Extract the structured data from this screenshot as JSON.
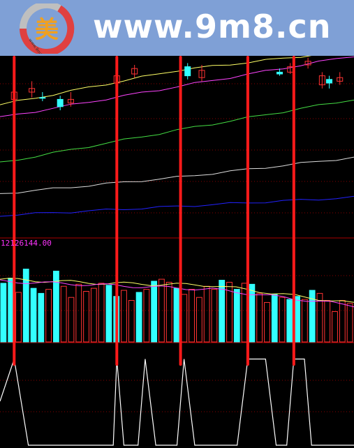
{
  "banner": {
    "site_text": "www.9m8.cn",
    "logo_char": "美",
    "logo_ring_text": "www.9m8.cn",
    "colors": {
      "background": "#7fa0d6",
      "text": "#ffffff",
      "logo_ring_gray": "#bfbfbf",
      "logo_ring_red": "#e04040",
      "logo_char": "#f0a020"
    }
  },
  "chart_data": [
    {
      "type": "line",
      "panel": "price",
      "title": "",
      "xlabel": "",
      "ylabel": "",
      "ylim": [
        0,
        100
      ],
      "grid": true,
      "x": [
        0,
        100
      ],
      "series": [
        {
          "values_y": [
            [
              0,
              73
            ],
            [
              50,
              92
            ],
            [
              100,
              103
            ]
          ],
          "color": "#ffff66"
        },
        {
          "values_y": [
            [
              0,
              66
            ],
            [
              50,
              83
            ],
            [
              100,
              100
            ]
          ],
          "color": "#ff44ff"
        },
        {
          "values_y": [
            [
              0,
              41
            ],
            [
              50,
              59
            ],
            [
              100,
              76
            ]
          ],
          "color": "#44dd44"
        },
        {
          "values_y": [
            [
              0,
              24
            ],
            [
              50,
              33
            ],
            [
              100,
              44
            ]
          ],
          "color": "#dddddd"
        },
        {
          "values_y": [
            [
              0,
              12
            ],
            [
              50,
              17
            ],
            [
              100,
              22
            ]
          ],
          "color": "#2222ff"
        }
      ],
      "candles": [
        {
          "x": 4,
          "open": 76,
          "close": 80,
          "high": 84,
          "low": 74,
          "up": true
        },
        {
          "x": 9,
          "open": 80,
          "close": 82,
          "high": 86,
          "low": 77,
          "up": true
        },
        {
          "x": 12,
          "open": 77,
          "close": 77,
          "high": 80,
          "low": 75,
          "up": false
        },
        {
          "x": 17,
          "open": 76,
          "close": 72,
          "high": 78,
          "low": 70,
          "up": false
        },
        {
          "x": 20,
          "open": 74,
          "close": 76,
          "high": 80,
          "low": 72,
          "up": true
        },
        {
          "x": 33,
          "open": 85,
          "close": 89,
          "high": 93,
          "low": 83,
          "up": true
        },
        {
          "x": 38,
          "open": 90,
          "close": 93,
          "high": 95,
          "low": 88,
          "up": true
        },
        {
          "x": 53,
          "open": 94,
          "close": 89,
          "high": 96,
          "low": 87,
          "up": false
        },
        {
          "x": 57,
          "open": 88,
          "close": 92,
          "high": 95,
          "low": 86,
          "up": true
        },
        {
          "x": 79,
          "open": 91,
          "close": 90,
          "high": 93,
          "low": 89,
          "up": false
        },
        {
          "x": 82,
          "open": 91,
          "close": 94,
          "high": 96,
          "low": 90,
          "up": true
        },
        {
          "x": 87,
          "open": 95,
          "close": 97,
          "high": 99,
          "low": 93,
          "up": true
        },
        {
          "x": 91,
          "open": 84,
          "close": 89,
          "high": 91,
          "low": 82,
          "up": true
        },
        {
          "x": 93,
          "open": 87,
          "close": 85,
          "high": 89,
          "low": 82,
          "up": false
        },
        {
          "x": 96,
          "open": 86,
          "close": 88,
          "high": 91,
          "low": 84,
          "up": true
        }
      ]
    },
    {
      "type": "bar",
      "panel": "volume",
      "title": "",
      "ylabel": "",
      "y_max_label": "12126144.00",
      "ylim": [
        0,
        100
      ],
      "grid": true,
      "values": [
        58,
        63,
        49,
        72,
        53,
        48,
        52,
        70,
        55,
        44,
        57,
        50,
        53,
        58,
        56,
        45,
        51,
        41,
        49,
        52,
        60,
        62,
        59,
        53,
        47,
        52,
        44,
        55,
        52,
        61,
        59,
        52,
        58,
        57,
        48,
        39,
        47,
        44,
        42,
        45,
        42,
        51,
        48,
        41,
        30,
        41,
        38
      ],
      "filled": [
        true,
        true,
        false,
        true,
        true,
        true,
        false,
        true,
        false,
        false,
        false,
        false,
        false,
        false,
        true,
        true,
        false,
        false,
        true,
        false,
        true,
        false,
        false,
        true,
        false,
        false,
        false,
        false,
        false,
        true,
        false,
        true,
        false,
        true,
        false,
        false,
        true,
        false,
        true,
        true,
        false,
        true,
        false,
        false,
        false,
        false,
        false
      ],
      "bar_colors": {
        "filled": "#33ffff",
        "hollow": "#ff3333"
      },
      "series": [
        {
          "values_y": [
            [
              0,
              62
            ],
            [
              30,
              58
            ],
            [
              60,
              56
            ],
            [
              100,
              38
            ]
          ],
          "color": "#ffff66"
        },
        {
          "values_y": [
            [
              0,
              60
            ],
            [
              30,
              56
            ],
            [
              60,
              52
            ],
            [
              100,
              36
            ]
          ],
          "color": "#ff44ff"
        }
      ]
    },
    {
      "type": "line",
      "panel": "signal",
      "title": "",
      "ylabel": "",
      "ylim": [
        0,
        1
      ],
      "grid": true,
      "signal_x": [
        4,
        33,
        51,
        70,
        83
      ],
      "series": [
        {
          "values_y": [
            [
              0,
              0.5
            ],
            [
              4,
              0.98
            ],
            [
              8,
              0.0
            ],
            [
              32,
              0.0
            ],
            [
              33,
              0.98
            ],
            [
              35,
              0.0
            ],
            [
              39,
              0.0
            ],
            [
              41,
              0.98
            ],
            [
              44,
              0.0
            ],
            [
              50,
              0.0
            ],
            [
              52,
              0.98
            ],
            [
              55,
              0.0
            ],
            [
              67,
              0.0
            ],
            [
              70,
              0.98
            ],
            [
              75,
              0.98
            ],
            [
              78,
              0.0
            ],
            [
              81,
              0.0
            ],
            [
              83,
              0.98
            ],
            [
              86,
              0.98
            ],
            [
              88,
              0.0
            ],
            [
              100,
              0.0
            ]
          ],
          "color": "#ffffff"
        }
      ]
    }
  ]
}
